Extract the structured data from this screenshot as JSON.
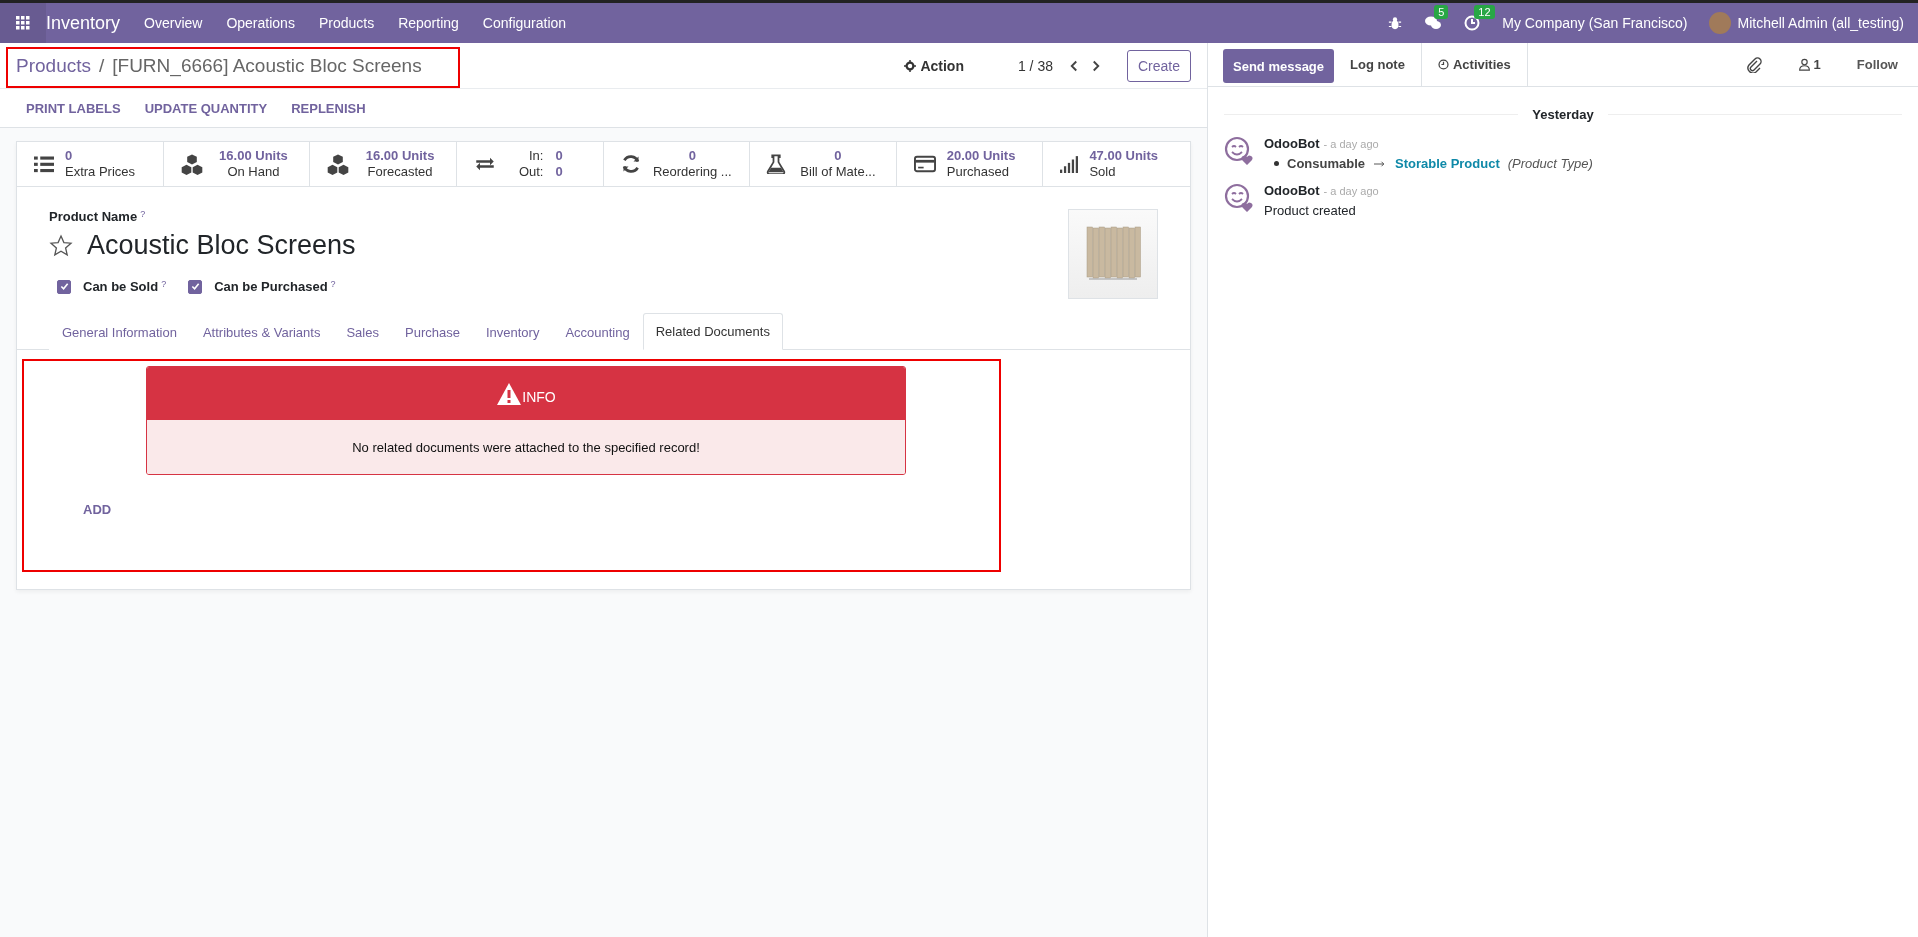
{
  "navbar": {
    "app_name": "Inventory",
    "menu": [
      "Overview",
      "Operations",
      "Products",
      "Reporting",
      "Configuration"
    ],
    "messages_count": "5",
    "activities_count": "12",
    "company": "My Company (San Francisco)",
    "user": "Mitchell Admin (all_testing)"
  },
  "control_panel": {
    "breadcrumb": [
      "Products",
      "[FURN_6666] Acoustic Bloc Screens"
    ],
    "separator": "/",
    "action": "Action",
    "pager": "1 / 38",
    "create": "Create"
  },
  "header_buttons": [
    "PRINT LABELS",
    "UPDATE QUANTITY",
    "REPLENISH"
  ],
  "stat_buttons": [
    {
      "kind": "single",
      "value": "0",
      "label": "Extra Prices"
    },
    {
      "kind": "single",
      "value": "16.00 Units",
      "label": "On Hand",
      "centered": true
    },
    {
      "kind": "single",
      "value": "16.00 Units",
      "label": "Forecasted",
      "centered": true
    },
    {
      "kind": "inout",
      "in_label": "In:",
      "in_value": "0",
      "out_label": "Out:",
      "out_value": "0"
    },
    {
      "kind": "single",
      "value": "0",
      "label": "Reordering ...",
      "centered": true
    },
    {
      "kind": "single",
      "value": "0",
      "label": "Bill of Mate...",
      "centered": true
    },
    {
      "kind": "single",
      "value": "20.00 Units",
      "label": "Purchased"
    },
    {
      "kind": "single",
      "value": "47.00 Units",
      "label": "Sold"
    }
  ],
  "product": {
    "name_label": "Product Name",
    "help": "?",
    "name": "Acoustic Bloc Screens",
    "starred": false,
    "checkboxes": [
      {
        "label": "Can be Sold",
        "help": "?",
        "checked": true
      },
      {
        "label": "Can be Purchased",
        "help": "?",
        "checked": true
      }
    ]
  },
  "tabs": [
    {
      "label": "General Information",
      "selected": false
    },
    {
      "label": "Attributes & Variants",
      "selected": false
    },
    {
      "label": "Sales",
      "selected": false
    },
    {
      "label": "Purchase",
      "selected": false
    },
    {
      "label": "Inventory",
      "selected": false
    },
    {
      "label": "Accounting",
      "selected": false
    },
    {
      "label": "Related Documents",
      "selected": true
    }
  ],
  "alert": {
    "title": "INFO",
    "message": "No related documents were attached to the specified record!"
  },
  "add_button": "ADD",
  "chatter": {
    "send_message": "Send message",
    "log_note": "Log note",
    "activities": "Activities",
    "followers": "1",
    "follow": "Follow",
    "date": "Yesterday",
    "messages": [
      {
        "kind": "tracking",
        "author": "OdooBot",
        "time": "- a day ago",
        "old_value": "Consumable",
        "new_value": "Storable Product",
        "field": "(Product Type)"
      },
      {
        "kind": "text",
        "author": "OdooBot",
        "time": "- a day ago",
        "body": "Product created"
      }
    ]
  }
}
